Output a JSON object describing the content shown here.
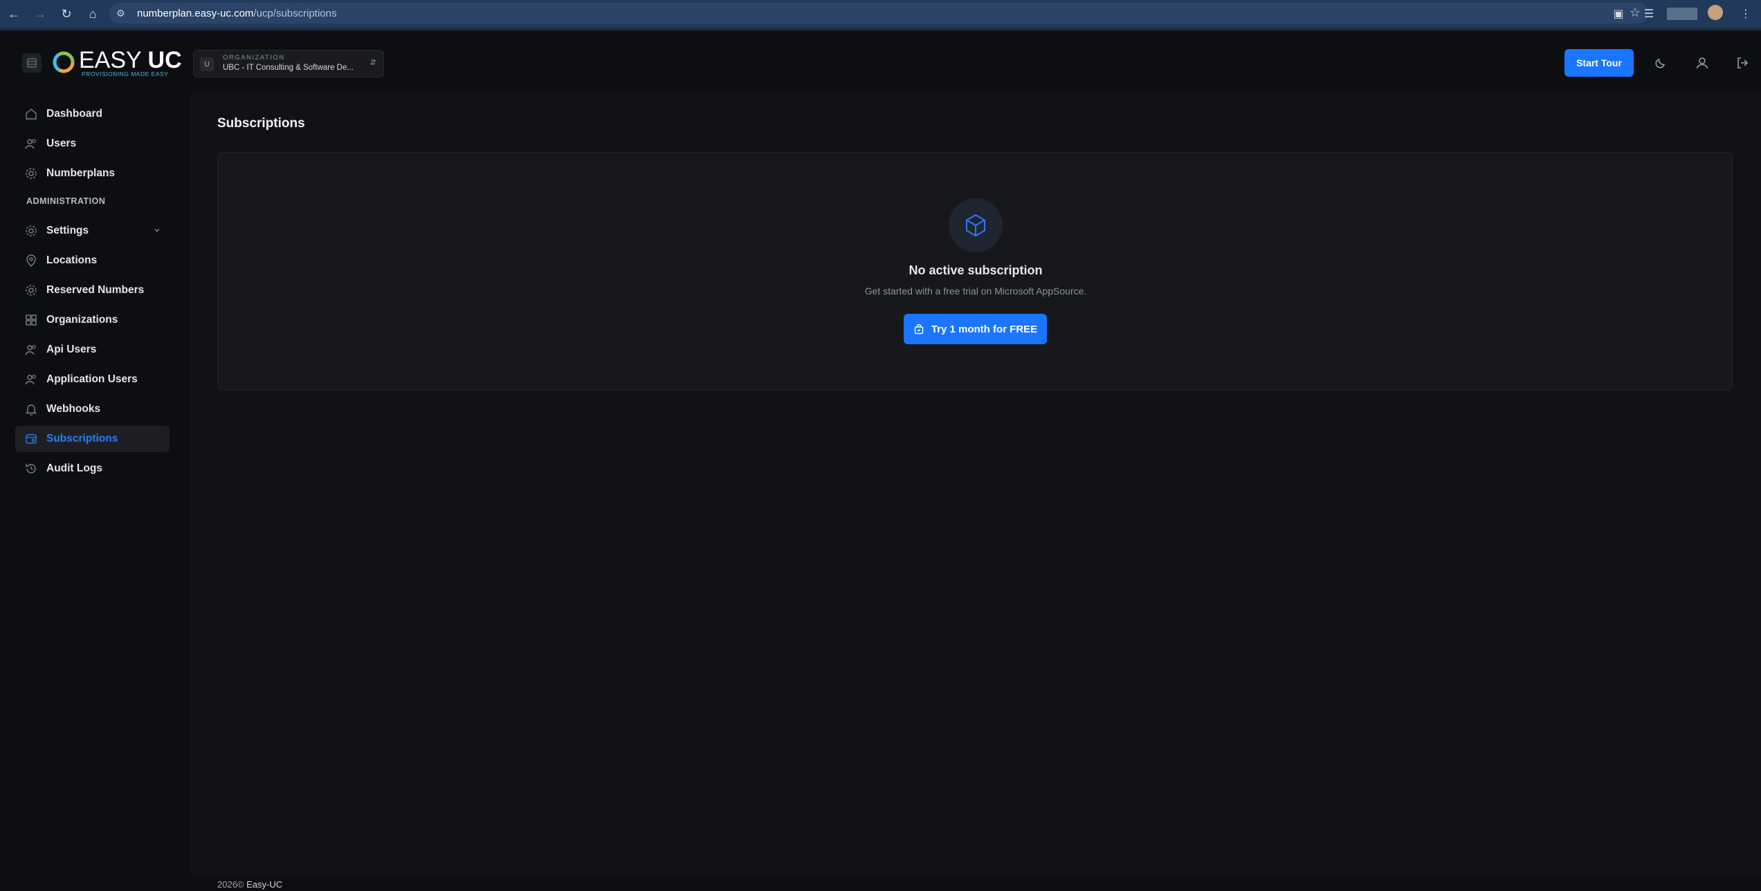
{
  "browser": {
    "url_host": "numberplan.easy-uc.com",
    "url_path": "/ucp/subscriptions"
  },
  "header": {
    "logo_text_light": "EASY ",
    "logo_text_bold": "UC",
    "logo_tagline": "PROVISIONING MADE EASY",
    "org_caption": "ORGANIZATION",
    "org_badge": "U",
    "org_name": "UBC - IT Consulting & Software De...",
    "start_tour_label": "Start Tour"
  },
  "sidebar": {
    "section_label": "ADMINISTRATION",
    "items": [
      {
        "label": "Dashboard",
        "icon": "home-icon"
      },
      {
        "label": "Users",
        "icon": "users-icon"
      },
      {
        "label": "Numberplans",
        "icon": "gear-icon"
      },
      {
        "label": "Settings",
        "icon": "gear-icon"
      },
      {
        "label": "Locations",
        "icon": "map-pin-icon"
      },
      {
        "label": "Reserved Numbers",
        "icon": "gear-icon"
      },
      {
        "label": "Organizations",
        "icon": "grid-icon"
      },
      {
        "label": "Api Users",
        "icon": "users-icon"
      },
      {
        "label": "Application Users",
        "icon": "users-icon"
      },
      {
        "label": "Webhooks",
        "icon": "bell-icon"
      },
      {
        "label": "Subscriptions",
        "icon": "subscription-icon",
        "active": true
      },
      {
        "label": "Audit Logs",
        "icon": "history-icon"
      }
    ]
  },
  "main": {
    "page_title": "Subscriptions",
    "empty_title": "No active subscription",
    "empty_subtitle": "Get started with a free trial on Microsoft AppSource.",
    "trial_button_label": "Try 1 month for FREE"
  },
  "footer": {
    "year_text": "2026© ",
    "brand": "Easy-UC"
  },
  "colors": {
    "accent": "#1a75ff",
    "active_label": "#2a7cf0",
    "background": "#0d0e12",
    "card": "#17181c"
  }
}
